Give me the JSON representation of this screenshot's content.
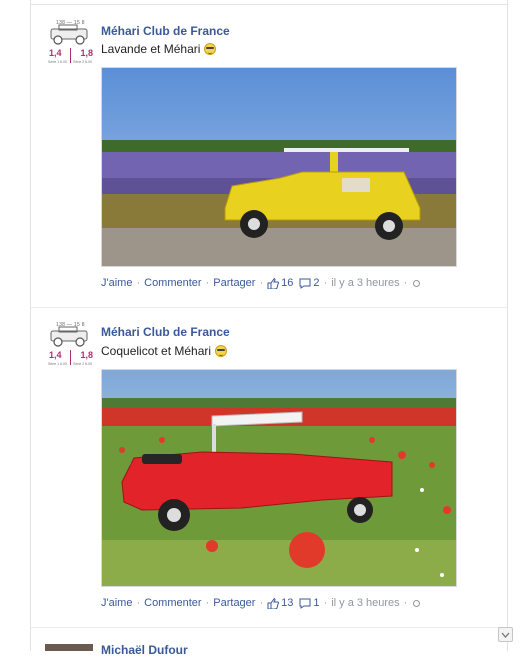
{
  "posts": [
    {
      "author": "Méhari Club de France",
      "avatar": {
        "top_text": "138 — 15 8",
        "left_num": "1,4",
        "right_num": "1,8",
        "left_sub": "Série 1 6.00",
        "right_sub": "Série 2 6.00"
      },
      "message": "Lavande et Méhari",
      "emoticon": "cool-sunglasses-smiley",
      "photo": {
        "subject": "yellow Méhari in lavender field",
        "car_color": "#e8d21f",
        "field_color": "#6b5aa6"
      },
      "actions": {
        "like": "J'aime",
        "comment": "Commenter",
        "share": "Partager"
      },
      "likes": "16",
      "comments": "2",
      "time": "il y a 3 heures"
    },
    {
      "author": "Méhari Club de France",
      "avatar": {
        "top_text": "138 — 15 8",
        "left_num": "1,4",
        "right_num": "1,8",
        "left_sub": "Série 1 6.00",
        "right_sub": "Série 2 6.00"
      },
      "message": "Coquelicot et Méhari",
      "emoticon": "cool-sunglasses-smiley",
      "photo": {
        "subject": "red Méhari in poppy field",
        "car_color": "#e3232a",
        "field_color": "#5d8a2e"
      },
      "actions": {
        "like": "J'aime",
        "comment": "Commenter",
        "share": "Partager"
      },
      "likes": "13",
      "comments": "1",
      "time": "il y a 3 heures"
    }
  ],
  "next_author": "Michaël Dufour",
  "colors": {
    "link": "#3b5998",
    "meta": "#9197a3",
    "accent_magenta": "#b22b74"
  }
}
